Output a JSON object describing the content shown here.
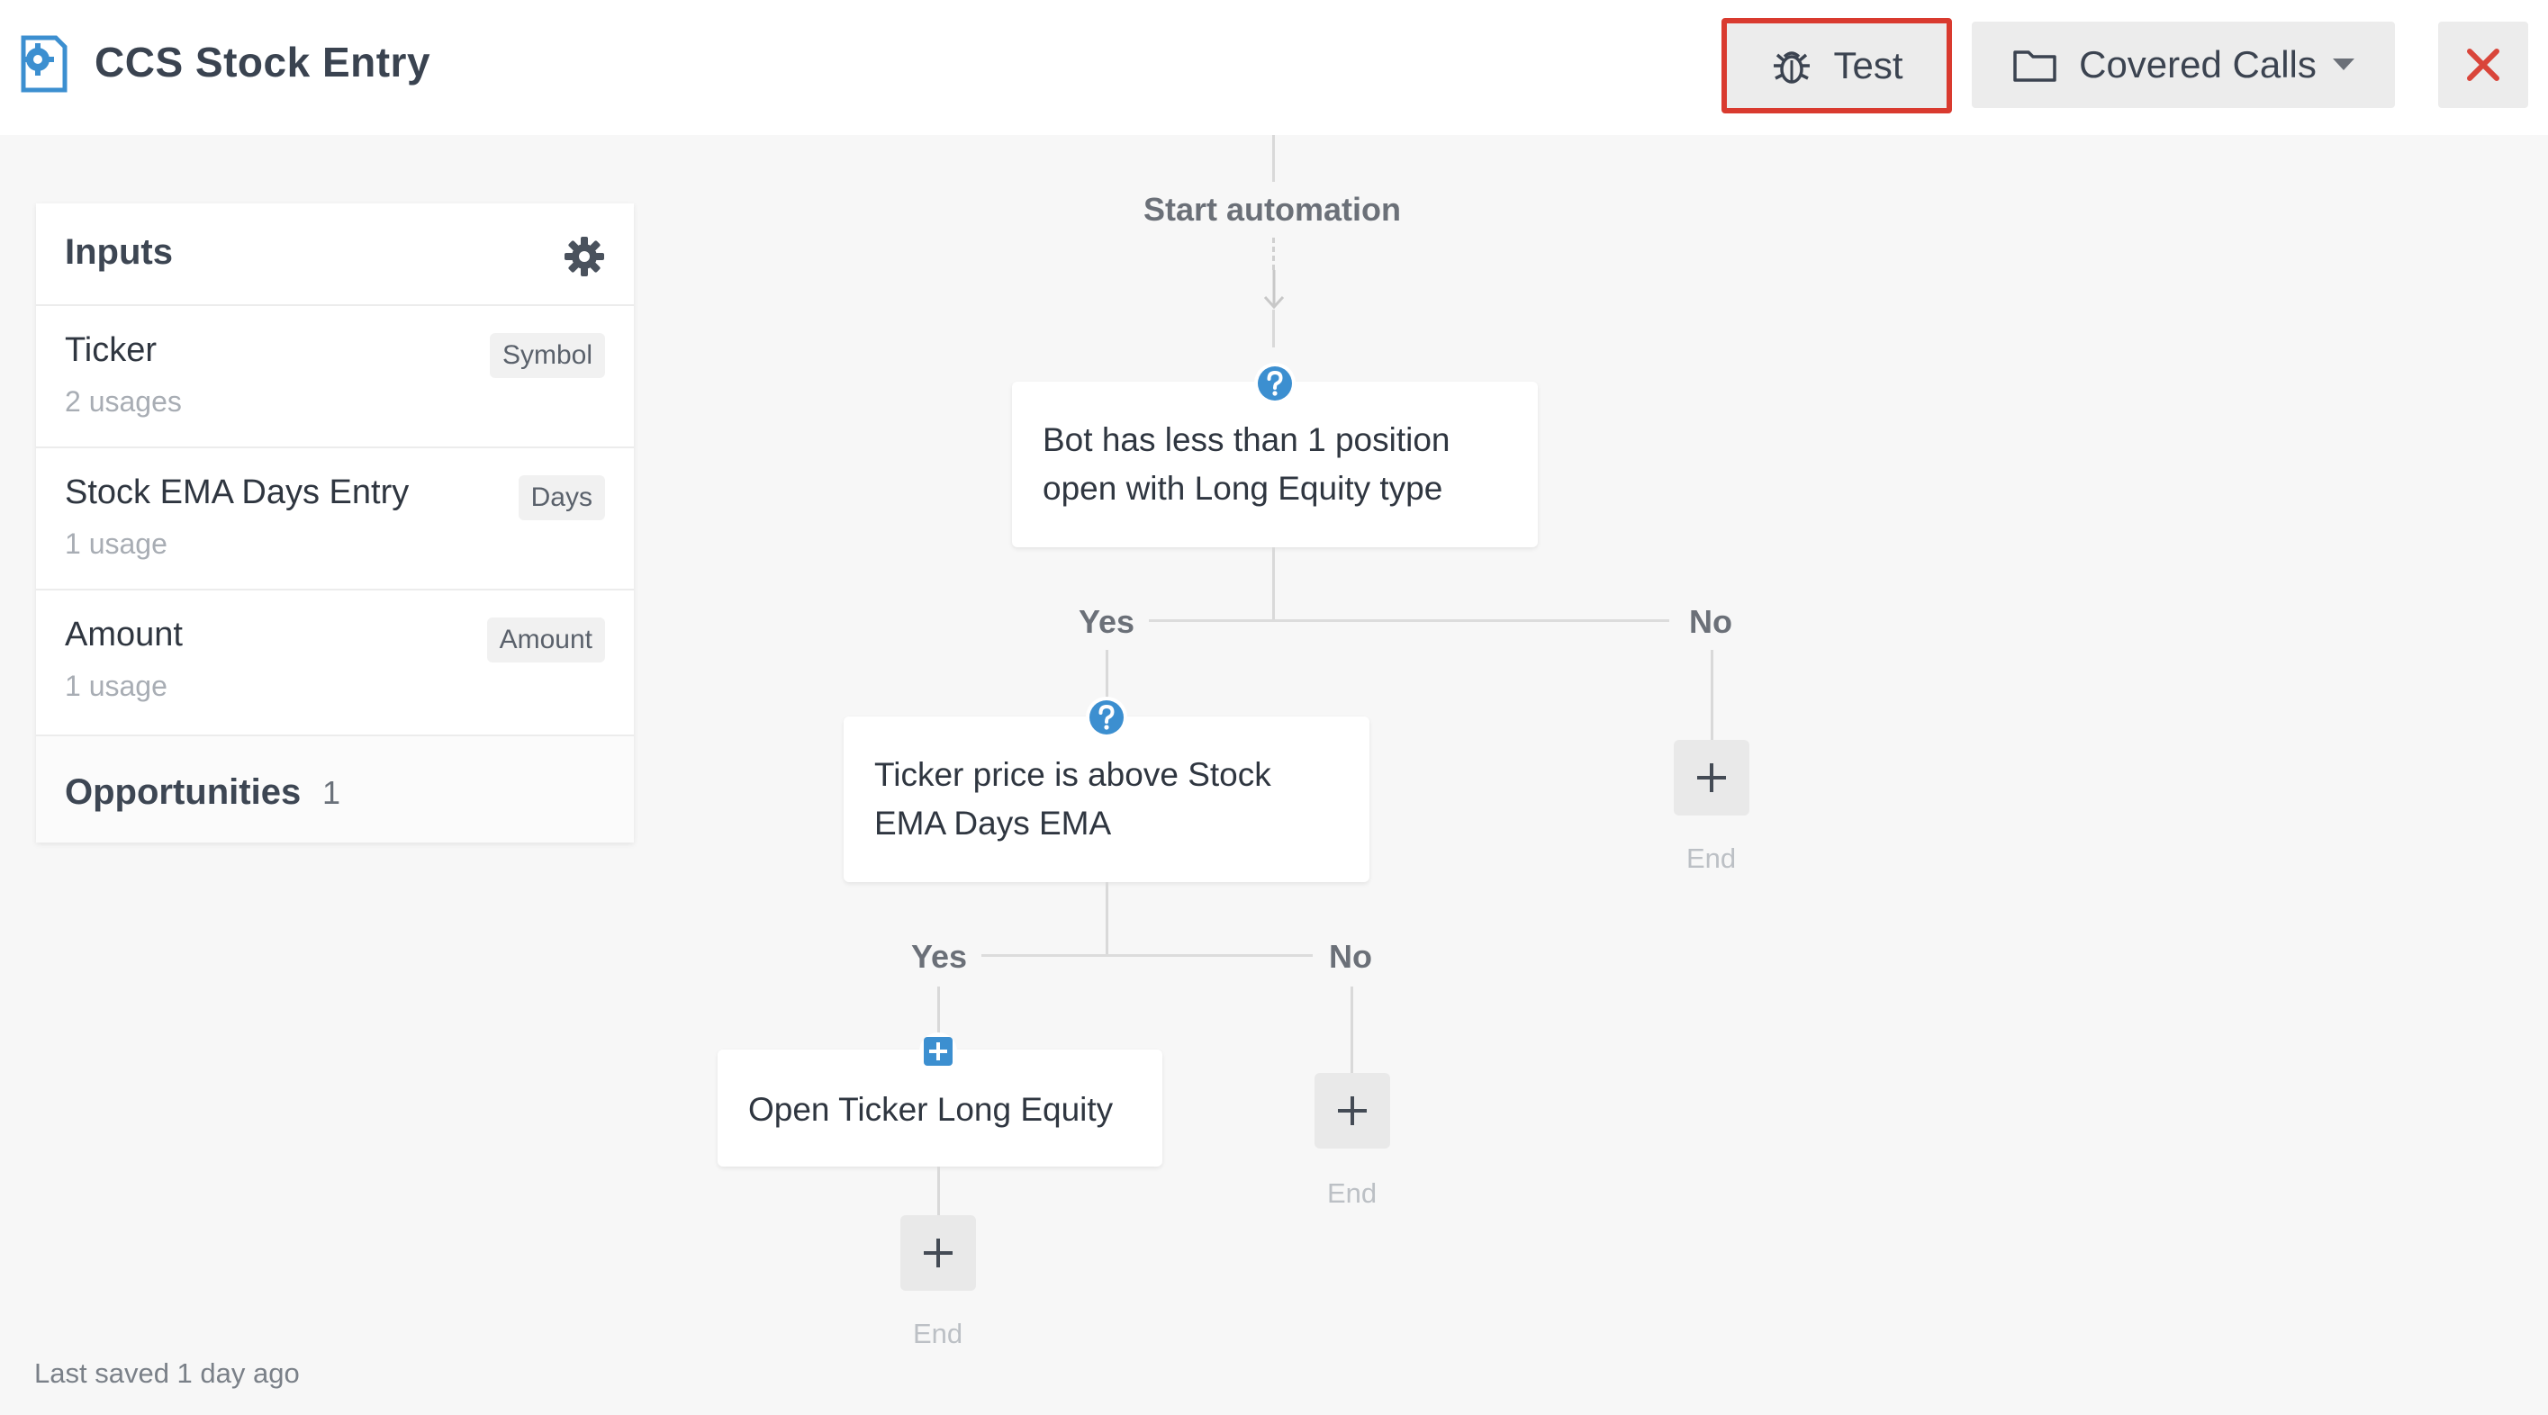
{
  "header": {
    "title": "CCS Stock Entry",
    "test_label": "Test",
    "folder_label": "Covered Calls"
  },
  "inputs_panel": {
    "title": "Inputs",
    "items": [
      {
        "name": "Ticker",
        "type": "Symbol",
        "usage": "2 usages"
      },
      {
        "name": "Stock EMA Days Entry",
        "type": "Days",
        "usage": "1 usage"
      },
      {
        "name": "Amount",
        "type": "Amount",
        "usage": "1 usage"
      }
    ],
    "opportunities_label": "Opportunities",
    "opportunities_count": "1"
  },
  "footer": {
    "last_saved": "Last saved 1 day ago"
  },
  "flow": {
    "start_label": "Start automation",
    "condition1": "Bot has less than 1 position open with Long Equity type",
    "condition2": "Ticker price is above Stock EMA Days EMA",
    "action1": "Open Ticker Long Equity",
    "yes_label": "Yes",
    "no_label": "No",
    "end_label": "End"
  },
  "colors": {
    "accent_blue": "#3c8fd0",
    "close_red": "#d9453a",
    "highlight_red": "#d93a2f"
  }
}
